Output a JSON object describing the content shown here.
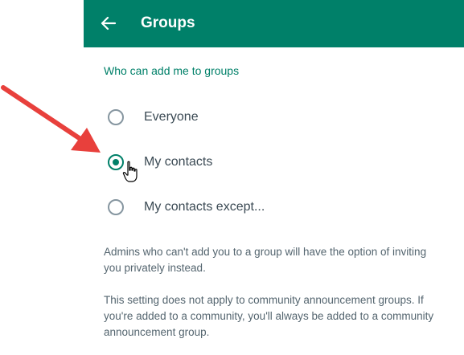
{
  "header": {
    "title": "Groups",
    "background": "#008069"
  },
  "section": {
    "label": "Who can add me to groups"
  },
  "options": [
    {
      "label": "Everyone",
      "selected": false
    },
    {
      "label": "My contacts",
      "selected": true
    },
    {
      "label": "My contacts except...",
      "selected": false
    }
  ],
  "info": {
    "paragraph1": "Admins who can't add you to a group will have the option of inviting you privately instead.",
    "paragraph2": "This setting does not apply to community announcement groups. If you're added to a community, you'll always be added to a community announcement group."
  },
  "colors": {
    "accent": "#008069",
    "annotation_arrow": "#e8403c"
  },
  "icons": {
    "back": "arrow-left-icon",
    "cursor": "hand-pointer-icon",
    "annotation": "red-arrow-annotation"
  }
}
